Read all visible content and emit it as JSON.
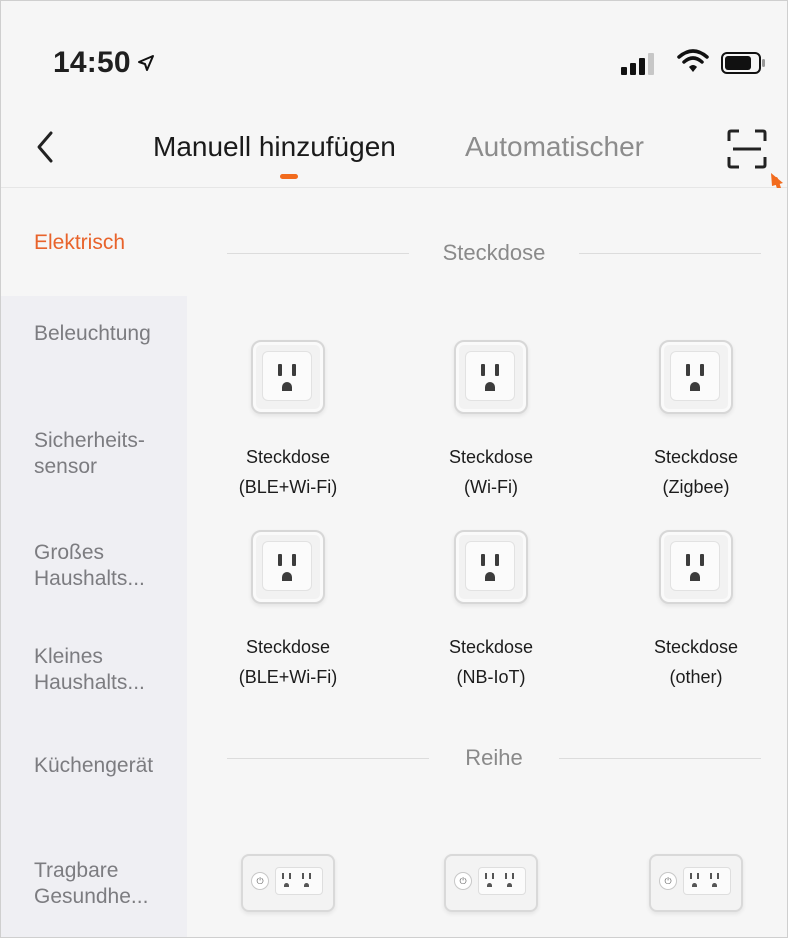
{
  "status_bar": {
    "time": "14:50",
    "location_icon": "location-arrow-icon",
    "signal_icon": "signal-bars-icon",
    "wifi_icon": "wifi-icon",
    "battery_icon": "battery-icon"
  },
  "header": {
    "back_icon": "chevron-left-icon",
    "tabs": [
      {
        "label": "Manuell hinzufügen",
        "active": true
      },
      {
        "label": "Automatischer",
        "active": false
      }
    ],
    "scan_icon": "scan-icon",
    "accent_color": "#f26b1d"
  },
  "sidebar": {
    "items": [
      {
        "label_lines": [
          "Elektrisch"
        ],
        "active": true
      },
      {
        "label_lines": [
          "Beleuchtung"
        ],
        "active": false
      },
      {
        "label_lines": [
          "Sicherheits-",
          "sensor"
        ],
        "active": false
      },
      {
        "label_lines": [
          "Großes",
          "Haushalts..."
        ],
        "active": false
      },
      {
        "label_lines": [
          "Kleines",
          "Haushalts..."
        ],
        "active": false
      },
      {
        "label_lines": [
          "Küchengerät"
        ],
        "active": false
      },
      {
        "label_lines": [
          "Tragbare",
          "Gesundhe..."
        ],
        "active": false
      }
    ]
  },
  "sections": [
    {
      "title": "Steckdose",
      "devices": [
        {
          "name_lines": [
            "Steckdose",
            "(BLE+Wi-Fi)"
          ],
          "icon": "wall-socket-icon"
        },
        {
          "name_lines": [
            "Steckdose",
            "(Wi-Fi)"
          ],
          "icon": "wall-socket-icon"
        },
        {
          "name_lines": [
            "Steckdose",
            "(Zigbee)"
          ],
          "icon": "wall-socket-icon"
        },
        {
          "name_lines": [
            "Steckdose",
            "(BLE+Wi-Fi)"
          ],
          "icon": "wall-socket-icon"
        },
        {
          "name_lines": [
            "Steckdose",
            "(NB-IoT)"
          ],
          "icon": "wall-socket-icon"
        },
        {
          "name_lines": [
            "Steckdose",
            "(other)"
          ],
          "icon": "wall-socket-icon"
        }
      ]
    },
    {
      "title": "Reihe",
      "devices": [
        {
          "icon": "power-strip-icon"
        },
        {
          "icon": "power-strip-icon"
        },
        {
          "icon": "power-strip-icon"
        }
      ]
    }
  ]
}
